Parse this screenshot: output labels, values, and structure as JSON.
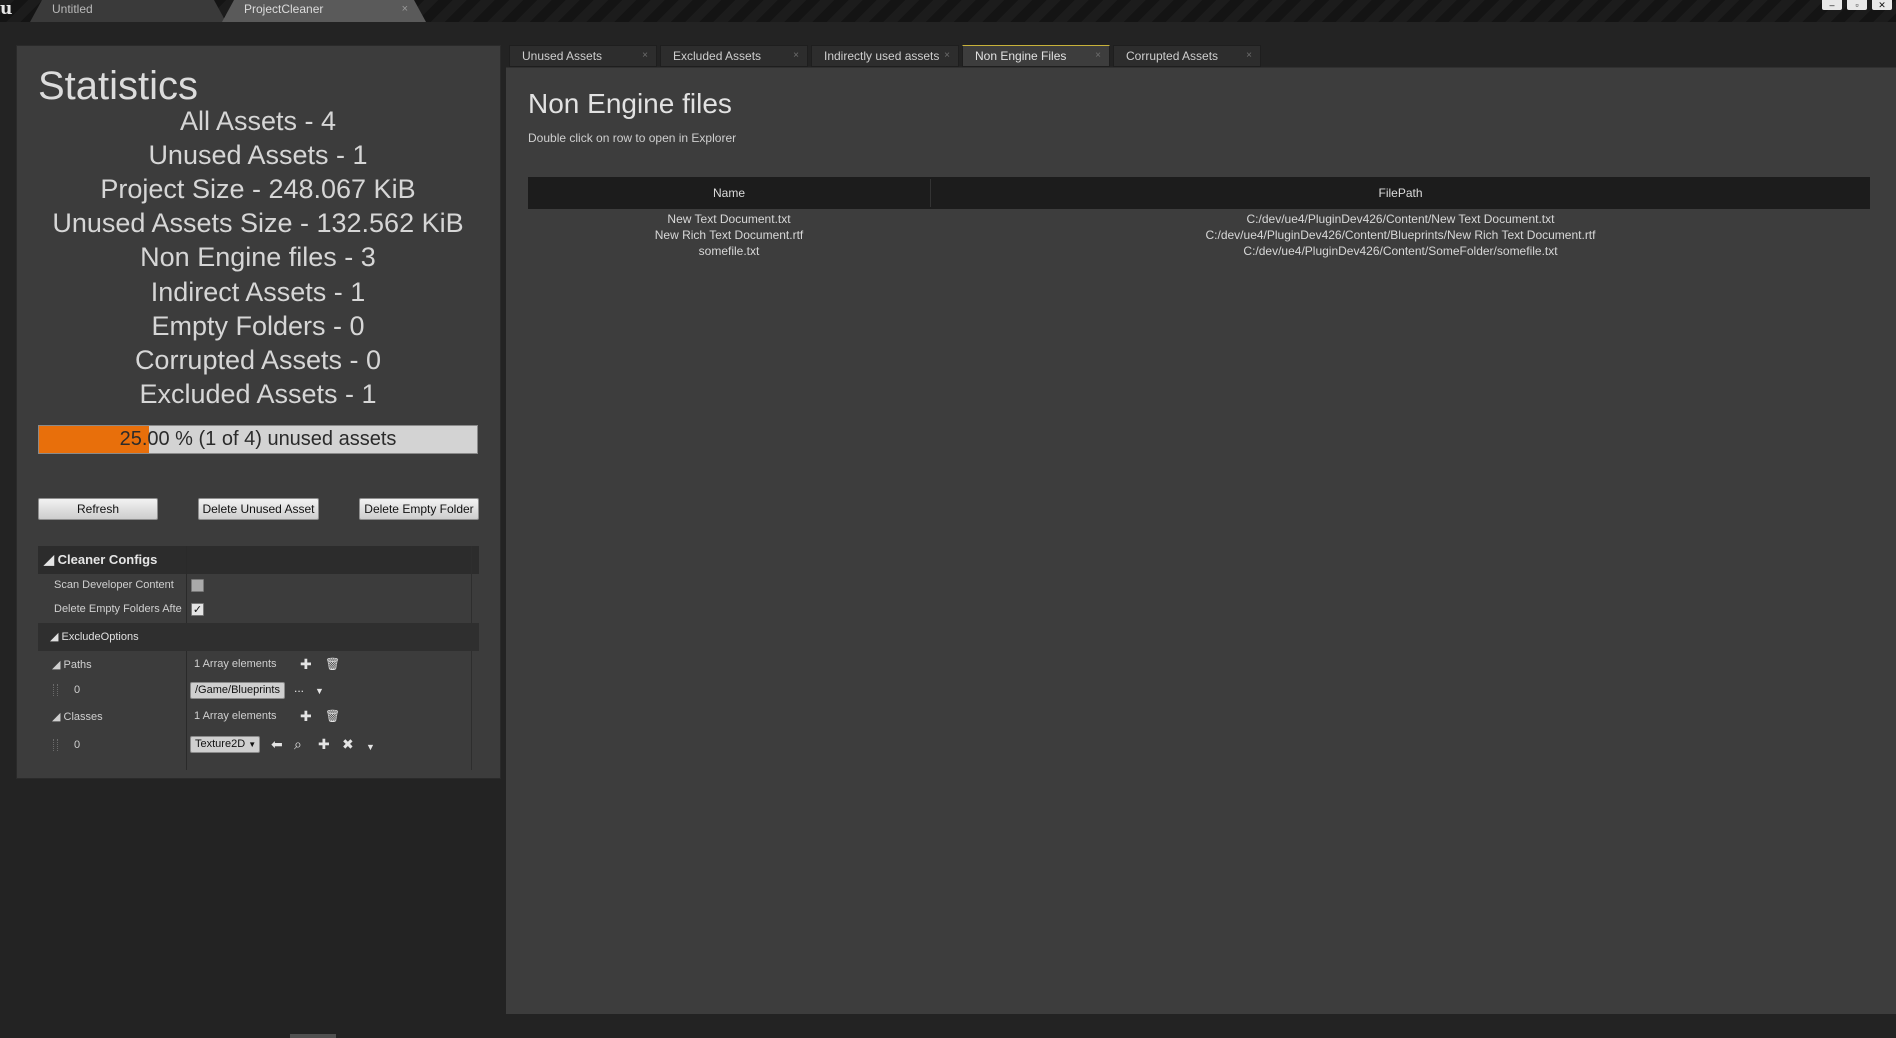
{
  "titlebar": {
    "tabs": [
      {
        "label": "Untitled"
      },
      {
        "label": "ProjectCleaner",
        "close": "×"
      }
    ],
    "window_controls": [
      "minimize-icon",
      "restore-icon",
      "close-icon"
    ]
  },
  "statistics": {
    "title": "Statistics",
    "lines": [
      "All Assets - 4",
      "Unused Assets - 1",
      "Project Size - 248.067 KiB",
      "Unused Assets Size - 132.562 KiB",
      "Non Engine files - 3",
      "Indirect Assets - 1",
      "Empty Folders - 0",
      "Corrupted Assets - 0",
      "Excluded Assets - 1"
    ],
    "progress": {
      "fraction": 0.25,
      "label": "25.00 % (1 of 4) unused assets",
      "fill_color": "#e86f0b"
    }
  },
  "buttons": {
    "refresh": "Refresh",
    "delete_unused": "Delete Unused Asset",
    "delete_empty": "Delete Empty Folder"
  },
  "cleaner_configs": {
    "title": "Cleaner Configs",
    "scan_developer_content": {
      "label": "Scan Developer Content",
      "checked": false
    },
    "delete_empty_folders": {
      "label": "Delete Empty Folders Afte",
      "checked": true
    },
    "exclude_options": {
      "title": "ExcludeOptions",
      "paths": {
        "label": "Paths",
        "count_text": "1 Array elements",
        "items": [
          {
            "index": "0",
            "value": "/Game/Blueprints"
          }
        ],
        "browse": "..."
      },
      "classes": {
        "label": "Classes",
        "count_text": "1 Array elements",
        "items": [
          {
            "index": "0",
            "value": "Texture2D"
          }
        ]
      }
    }
  },
  "right_tabs": [
    {
      "label": "Unused Assets",
      "active": false
    },
    {
      "label": "Excluded Assets",
      "active": false
    },
    {
      "label": "Indirectly used assets",
      "active": false
    },
    {
      "label": "Non Engine Files",
      "active": true
    },
    {
      "label": "Corrupted Assets",
      "active": false
    }
  ],
  "tab_close": "×",
  "non_engine": {
    "title": "Non Engine files",
    "subtitle": "Double click on row to open in Explorer",
    "columns": [
      "Name",
      "FilePath"
    ],
    "rows": [
      {
        "name": "New Text Document.txt",
        "path": "C:/dev/ue4/PluginDev426/Content/New Text Document.txt"
      },
      {
        "name": "New Rich Text Document.rtf",
        "path": "C:/dev/ue4/PluginDev426/Content/Blueprints/New Rich Text Document.rtf"
      },
      {
        "name": "somefile.txt",
        "path": "C:/dev/ue4/PluginDev426/Content/SomeFolder/somefile.txt"
      }
    ]
  }
}
